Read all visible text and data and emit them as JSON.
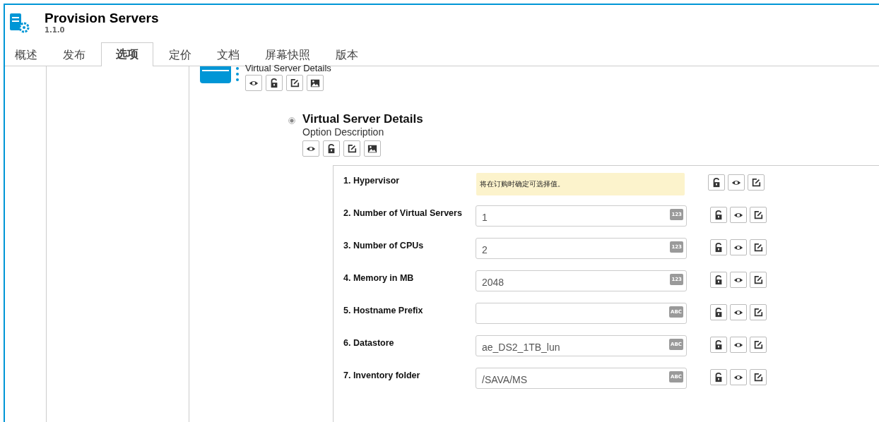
{
  "app": {
    "title": "Provision Servers",
    "version": "1.1.0"
  },
  "tabs": [
    {
      "label": "概述",
      "selected": false
    },
    {
      "label": "发布",
      "selected": false
    },
    {
      "label": "选项",
      "selected": true
    },
    {
      "label": "定价",
      "selected": false
    },
    {
      "label": "文档",
      "selected": false
    },
    {
      "label": "屏幕快照",
      "selected": false
    },
    {
      "label": "版本",
      "selected": false
    }
  ],
  "option_set": {
    "title": "Virtual Server Details"
  },
  "option": {
    "title": "Virtual Server Details",
    "description": "Option Description",
    "selected": true
  },
  "fields": [
    {
      "kind": "note",
      "label": "1. Hypervisor",
      "note": "将在订购时确定可选择值。"
    },
    {
      "kind": "input",
      "label": "2. Number of Virtual Servers",
      "value": "1",
      "badge": "123"
    },
    {
      "kind": "input",
      "label": "3. Number of CPUs",
      "value": "2",
      "badge": "123"
    },
    {
      "kind": "input",
      "label": "4. Memory in MB",
      "value": "2048",
      "badge": "123"
    },
    {
      "kind": "input",
      "label": "5. Hostname Prefix",
      "badge": "ABC"
    },
    {
      "kind": "input",
      "label": "6. Datastore",
      "value": "ae_DS2_1TB_lun",
      "badge": "ABC"
    },
    {
      "kind": "input",
      "label": "7. Inventory folder",
      "value": "/SAVA/MS",
      "badge": "ABC"
    }
  ]
}
